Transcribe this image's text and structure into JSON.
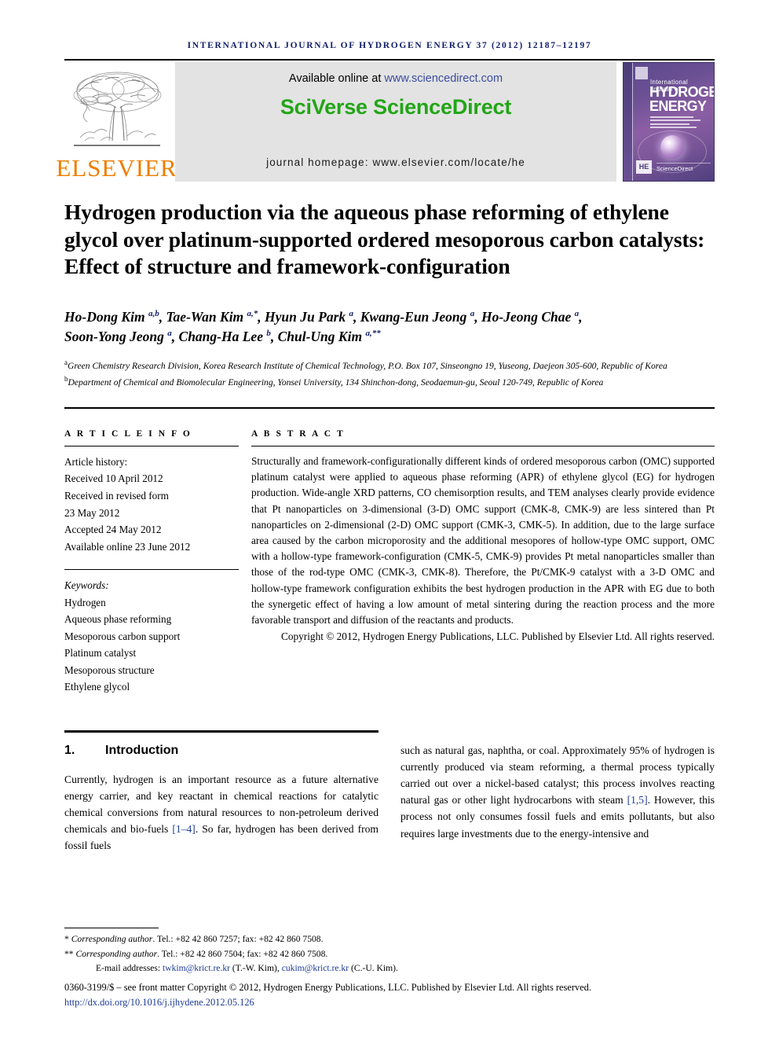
{
  "running_head": "INTERNATIONAL JOURNAL OF HYDROGEN ENERGY 37 (2012) 12187–12197",
  "masthead": {
    "publisher_name": "ELSEVIER",
    "available_prefix": "Available online at ",
    "available_url": "www.sciencedirect.com",
    "brand": "SciVerse ScienceDirect",
    "homepage": "journal homepage: www.elsevier.com/locate/he",
    "cover": {
      "line1": "International Journal of",
      "line2": "HYDROGEN",
      "line3": "ENERGY",
      "badge": "HE",
      "sciencedirect": "ScienceDirect"
    }
  },
  "article": {
    "title": "Hydrogen production via the aqueous phase reforming of ethylene glycol over platinum-supported ordered mesoporous carbon catalysts: Effect of structure and framework-configuration",
    "authors_line1_html": "Ho-Dong Kim <sup>a,b</sup>, Tae-Wan Kim <sup>a,*</sup>, Hyun Ju Park <sup>a</sup>, Kwang-Eun Jeong <sup>a</sup>, Ho-Jeong Chae <sup>a</sup>,",
    "authors_line2_html": "Soon-Yong Jeong <sup>a</sup>, Chang-Ha Lee <sup>b</sup>, Chul-Ung Kim <sup>a,**</sup>",
    "affiliation_a": "Green Chemistry Research Division, Korea Research Institute of Chemical Technology, P.O. Box 107, Sinseongno 19, Yuseong, Daejeon 305-600, Republic of Korea",
    "affiliation_b": "Department of Chemical and Biomolecular Engineering, Yonsei University, 134 Shinchon-dong, Seodaemun-gu, Seoul 120-749, Republic of Korea"
  },
  "article_info": {
    "heading": "A R T I C L E  I N F O",
    "history_label": "Article history:",
    "history": [
      "Received 10 April 2012",
      "Received in revised form",
      "23 May 2012",
      "Accepted 24 May 2012",
      "Available online 23 June 2012"
    ],
    "keywords_label": "Keywords:",
    "keywords": [
      "Hydrogen",
      "Aqueous phase reforming",
      "Mesoporous carbon support",
      "Platinum catalyst",
      "Mesoporous structure",
      "Ethylene glycol"
    ]
  },
  "abstract": {
    "heading": "A B S T R A C T",
    "text": "Structurally and framework-configurationally different kinds of ordered mesoporous carbon (OMC) supported platinum catalyst were applied to aqueous phase reforming (APR) of ethylene glycol (EG) for hydrogen production. Wide-angle XRD patterns, CO chemisorption results, and TEM analyses clearly provide evidence that Pt nanoparticles on 3-dimensional (3-D) OMC support (CMK-8, CMK-9) are less sintered than Pt nanoparticles on 2-dimensional (2-D) OMC support (CMK-3, CMK-5). In addition, due to the large surface area caused by the carbon microporosity and the additional mesopores of hollow-type OMC support, OMC with a hollow-type framework-configuration (CMK-5, CMK-9) provides Pt metal nanoparticles smaller than those of the rod-type OMC (CMK-3, CMK-8). Therefore, the Pt/CMK-9 catalyst with a 3-D OMC and hollow-type framework configuration exhibits the best hydrogen production in the APR with EG due to both the synergetic effect of having a low amount of metal sintering during the reaction process and the more favorable transport and diffusion of the reactants and products.",
    "copyright": "Copyright © 2012, Hydrogen Energy Publications, LLC. Published by Elsevier Ltd. All rights reserved."
  },
  "introduction": {
    "number": "1.",
    "title": "Introduction",
    "left_para_html": "Currently, hydrogen is an important resource as a future alternative energy carrier, and key reactant in chemical reactions for catalytic chemical conversions from natural resources to non-petroleum derived chemicals and bio-fuels <span class=\"ref\" data-name=\"citation-link\">[1&#8211;4]</span>. So far, hydrogen has been derived from fossil fuels",
    "right_para_html": "such as natural gas, naphtha, or coal. Approximately 95% of hydrogen is currently produced via steam reforming, a thermal process typically carried out over a nickel-based catalyst; this process involves reacting natural gas or other light hydrocarbons with steam <span class=\"ref\" data-name=\"citation-link\">[1,5]</span>. However, this process not only consumes fossil fuels and emits pollutants, but also requires large investments due to the energy-intensive and"
  },
  "footnotes": {
    "corresponding_1_html": "<span class=\"mark\">*</span> <em>Corresponding author</em>. Tel.: +82 42 860 7257; fax: +82 42 860 7508.",
    "corresponding_2_html": "<span class=\"mark\">**</span> <em>Corresponding author</em>. Tel.: +82 42 860 7504; fax: +82 42 860 7508.",
    "email_html": "E-mail addresses: <a class=\"email\" data-name=\"email-link-twkim\">twkim@krict.re.kr</a> (T.-W. Kim), <a class=\"email\" data-name=\"email-link-cukim\">cukim@krict.re.kr</a> (C.-U. Kim).",
    "issn": "0360-3199/$ – see front matter Copyright © 2012, Hydrogen Energy Publications, LLC. Published by Elsevier Ltd. All rights reserved.",
    "doi": "http://dx.doi.org/10.1016/j.ijhydene.2012.05.126"
  },
  "colors": {
    "running_head": "#14216b",
    "brand_green": "#22a616",
    "elsevier_orange": "#ef7d00",
    "link_blue": "#1c3c97",
    "band_gray": "#e3e3e3"
  }
}
